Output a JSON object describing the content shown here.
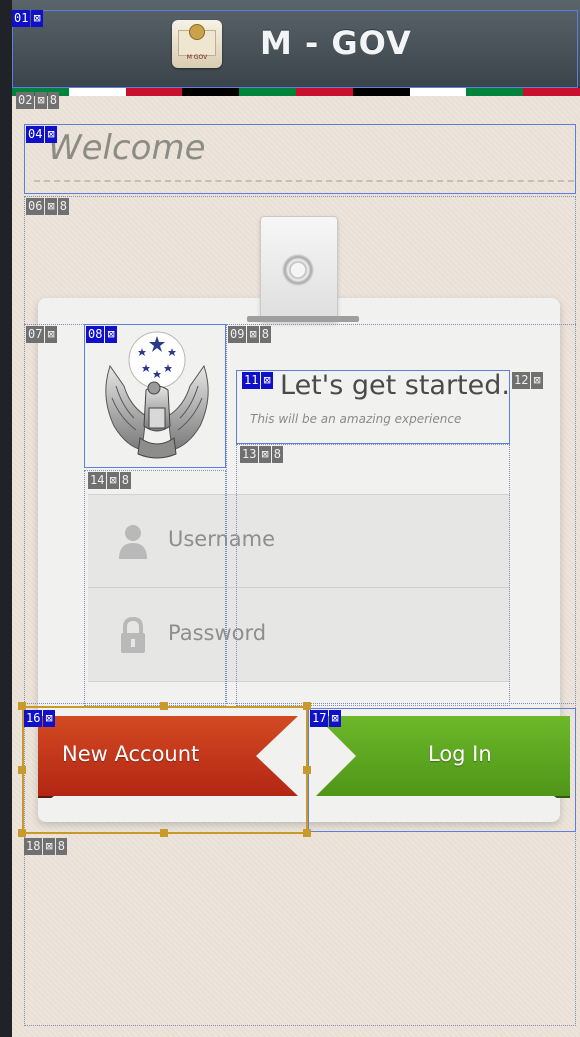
{
  "app": {
    "title": "M - GOV",
    "logo_text": "M GOV"
  },
  "welcome": {
    "text": "Welcome"
  },
  "card": {
    "title": "Let's get started.",
    "subtitle": "This will be an amazing experience"
  },
  "form": {
    "username_label": "Username",
    "password_label": "Password"
  },
  "buttons": {
    "new_account": "New Account",
    "log_in": "Log In"
  },
  "colors": {
    "header": "#4a545b",
    "new_account": "#c43a1c",
    "log_in": "#5aa51d",
    "flag_red": "#c8102e",
    "flag_green": "#00843d",
    "flag_black": "#000000",
    "flag_white": "#ffffff"
  },
  "annotations": {
    "tags": [
      {
        "num": "01",
        "icon": "image"
      },
      {
        "num": "02",
        "count": "8"
      },
      {
        "num": "04",
        "icon": "image"
      },
      {
        "num": "06",
        "count": "8"
      },
      {
        "num": "07",
        "count": ""
      },
      {
        "num": "08",
        "icon": "image"
      },
      {
        "num": "09",
        "count": "8"
      },
      {
        "num": "11",
        "icon": "image"
      },
      {
        "num": "12",
        "count": ""
      },
      {
        "num": "13",
        "count": "8"
      },
      {
        "num": "14",
        "count": "8"
      },
      {
        "num": "16",
        "icon": "image"
      },
      {
        "num": "17",
        "icon": "image"
      },
      {
        "num": "18",
        "count": "8"
      }
    ]
  }
}
